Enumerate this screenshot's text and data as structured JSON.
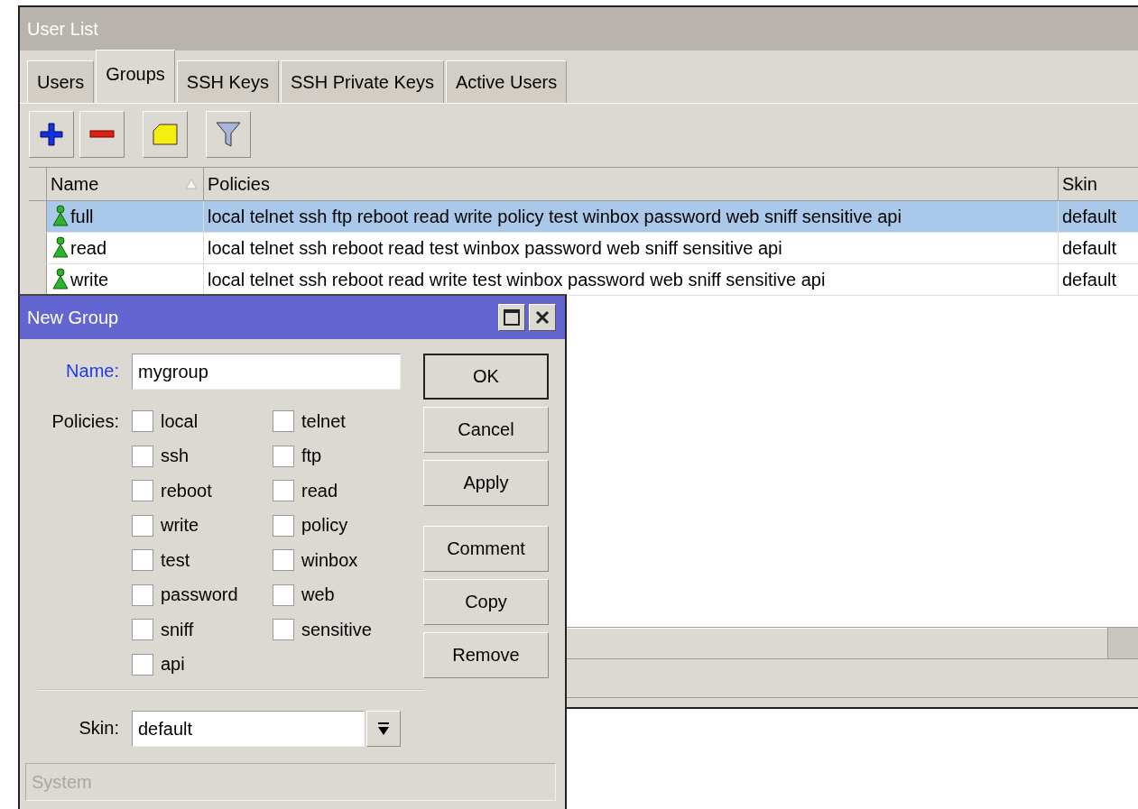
{
  "user_list": {
    "title": "User List",
    "tabs": [
      {
        "label": "Users",
        "selected": false
      },
      {
        "label": "Groups",
        "selected": true
      },
      {
        "label": "SSH Keys",
        "selected": false
      },
      {
        "label": "SSH Private Keys",
        "selected": false
      },
      {
        "label": "Active Users",
        "selected": false
      }
    ],
    "table": {
      "columns": [
        "Name",
        "Policies",
        "Skin"
      ],
      "rows": [
        {
          "name": "full",
          "policies": "local telnet ssh ftp reboot read write policy test winbox password web sniff sensitive api",
          "skin": "default",
          "selected": true
        },
        {
          "name": "read",
          "policies": "local telnet ssh reboot read test winbox password web sniff sensitive api",
          "skin": "default",
          "selected": false
        },
        {
          "name": "write",
          "policies": "local telnet ssh reboot read write test winbox password web sniff sensitive api",
          "skin": "default",
          "selected": false
        }
      ]
    }
  },
  "new_group": {
    "title": "New Group",
    "name_label": "Name:",
    "name_value": "mygroup",
    "policies_label": "Policies:",
    "policies": [
      {
        "label": "local",
        "checked": false
      },
      {
        "label": "telnet",
        "checked": false
      },
      {
        "label": "ssh",
        "checked": false
      },
      {
        "label": "ftp",
        "checked": false
      },
      {
        "label": "reboot",
        "checked": false
      },
      {
        "label": "read",
        "checked": false
      },
      {
        "label": "write",
        "checked": false
      },
      {
        "label": "policy",
        "checked": false
      },
      {
        "label": "test",
        "checked": false
      },
      {
        "label": "winbox",
        "checked": false
      },
      {
        "label": "password",
        "checked": false
      },
      {
        "label": "web",
        "checked": false
      },
      {
        "label": "sniff",
        "checked": false
      },
      {
        "label": "sensitive",
        "checked": false
      },
      {
        "label": "api",
        "checked": false
      }
    ],
    "skin_label": "Skin:",
    "skin_value": "default",
    "status": "System",
    "button_groups": [
      [
        {
          "label": "OK",
          "default": true
        },
        {
          "label": "Cancel",
          "default": false
        },
        {
          "label": "Apply",
          "default": false
        }
      ],
      [
        {
          "label": "Comment",
          "default": false
        },
        {
          "label": "Copy",
          "default": false
        },
        {
          "label": "Remove",
          "default": false
        }
      ]
    ]
  }
}
